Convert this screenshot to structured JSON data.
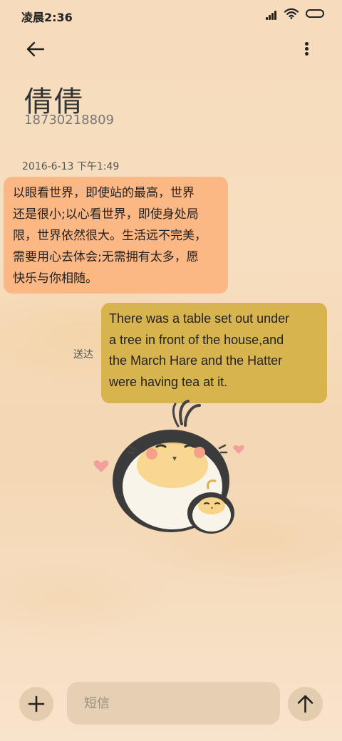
{
  "status_bar": {
    "time": "凌晨2:36",
    "icons": [
      "signal-icon",
      "wifi-icon",
      "battery-icon"
    ]
  },
  "app_bar": {
    "back_icon": "arrow-left-icon",
    "more_icon": "more-vertical-icon"
  },
  "contact": {
    "name": "倩倩",
    "number": "18730218809"
  },
  "conversation": {
    "timestamp": "2016-6-13 下午1:49",
    "incoming": {
      "lines": [
        "以眼看世界，即使站的最高，世界",
        "还是很小;以心看世界，即使身处局",
        "限，世界依然很大。生活远不完美，",
        "需要用心去体会;无需拥有太多，愿",
        "快乐与你相随。"
      ]
    },
    "outgoing": {
      "status": "送达",
      "lines": [
        "There was a table set out under",
        "a tree in front of the house,and",
        "the March Hare and the Hatter",
        "were having tea at it."
      ]
    }
  },
  "composer": {
    "add_icon": "plus-icon",
    "placeholder": "短信",
    "value": "",
    "send_icon": "arrow-up-icon"
  },
  "colors": {
    "incoming_bubble": "#fbb784",
    "outgoing_bubble": "#d8b44e",
    "background": "#f6dcbc"
  }
}
